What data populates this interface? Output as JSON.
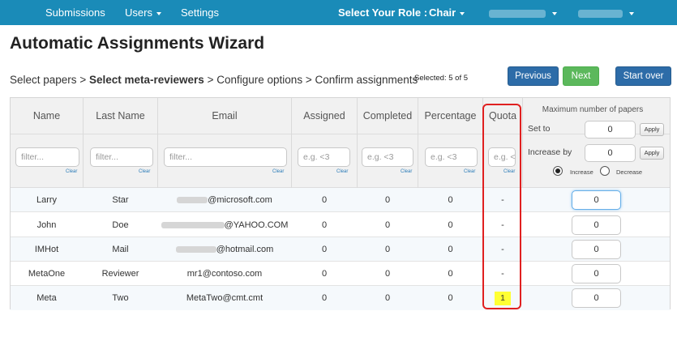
{
  "nav": {
    "submissions": "Submissions",
    "users": "Users",
    "settings": "Settings",
    "role_label": "Select Your Role :",
    "role_value": "Chair"
  },
  "page": {
    "title": "Automatic Assignments Wizard",
    "breadcrumb": {
      "step1": "Select papers",
      "sep": ">",
      "step2": "Select meta-reviewers",
      "step3": "Configure options",
      "step4": "Confirm assignments"
    },
    "selected": "Selected: 5 of 5"
  },
  "buttons": {
    "previous": "Previous",
    "next": "Next",
    "start_over": "Start over"
  },
  "table": {
    "headers": [
      "Name",
      "Last Name",
      "Email",
      "Assigned",
      "Completed",
      "Percentage",
      "Quota"
    ],
    "filter_placeholders": [
      "filter...",
      "filter...",
      "filter...",
      "e.g. <3",
      "e.g. <3",
      "e.g. <3",
      "e.g. <3"
    ],
    "clear_label": "Clear",
    "max_panel": {
      "title": "Maximum number of papers",
      "set_to_label": "Set to",
      "set_to_value": "0",
      "increase_by_label": "Increase by",
      "increase_by_value": "0",
      "apply_label": "Apply",
      "radio_increase": "Increase",
      "radio_decrease": "Decrease",
      "selected_radio": "Increase"
    },
    "rows": [
      {
        "name": "Larry",
        "last": "Star",
        "email": "@microsoft.com",
        "assigned": "0",
        "completed": "0",
        "percentage": "0",
        "quota": "-",
        "max": "0"
      },
      {
        "name": "John",
        "last": "Doe",
        "email": "@YAHOO.COM",
        "assigned": "0",
        "completed": "0",
        "percentage": "0",
        "quota": "-",
        "max": "0"
      },
      {
        "name": "IMHot",
        "last": "Mail",
        "email": "@hotmail.com",
        "assigned": "0",
        "completed": "0",
        "percentage": "0",
        "quota": "-",
        "max": "0"
      },
      {
        "name": "MetaOne",
        "last": "Reviewer",
        "email": "mr1@contoso.com",
        "assigned": "0",
        "completed": "0",
        "percentage": "0",
        "quota": "-",
        "max": "0"
      },
      {
        "name": "Meta",
        "last": "Two",
        "email": "MetaTwo@cmt.cmt",
        "assigned": "0",
        "completed": "0",
        "percentage": "0",
        "quota": "1",
        "max": "0"
      }
    ]
  },
  "colors": {
    "navbar": "#1a8bb8",
    "primary_button": "#2d6ca8",
    "success_button": "#5cb85c",
    "highlight_border": "#e02020",
    "quota_highlight": "#ffff33"
  }
}
